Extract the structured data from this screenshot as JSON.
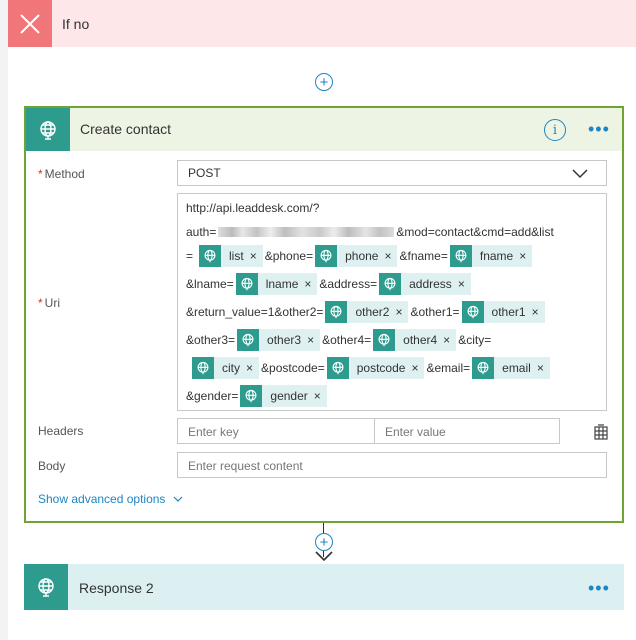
{
  "if_no": {
    "label": "If no"
  },
  "card": {
    "title": "Create contact",
    "info_icon": "info-icon",
    "more_icon": "ellipsis-icon",
    "method": {
      "label": "Method",
      "value": "POST"
    },
    "uri": {
      "label": "Uri",
      "line1": "http://api.leaddesk.com/?",
      "line2_prefix": "auth=",
      "line2_suffix": "&mod=contact&cmd=add&list",
      "line3_prefix": "=",
      "line3_t2": "&phone=",
      "line3_t3": "&fname=",
      "line4_prefix": "&lname=",
      "line4_t2": "&address=",
      "line5_prefix": "&return_value=1&other2=",
      "line5_t2": "&other1=",
      "line6_prefix": "&other3=",
      "line6_t2": "&other4=",
      "line6_t3": "&city=",
      "line7_t1": "&postcode=",
      "line7_t2": "&email=",
      "line8_prefix": "&gender=",
      "tokens": {
        "list": "list",
        "phone": "phone",
        "fname": "fname",
        "lname": "lname",
        "address": "address",
        "other2": "other2",
        "other1": "other1",
        "other3": "other3",
        "other4": "other4",
        "city": "city",
        "postcode": "postcode",
        "email": "email",
        "gender": "gender"
      },
      "remove_glyph": "×"
    },
    "headers": {
      "label": "Headers",
      "key_placeholder": "Enter key",
      "value_placeholder": "Enter value"
    },
    "body": {
      "label": "Body",
      "placeholder": "Enter request content"
    },
    "advanced": {
      "label": "Show advanced options"
    }
  },
  "response": {
    "title": "Response 2"
  },
  "colors": {
    "accent": "#1f85c2",
    "card_border": "#70a432",
    "connector": "#2d9c8f",
    "if_no_bg": "#fde7e9",
    "if_no_icon": "#f0767a"
  }
}
